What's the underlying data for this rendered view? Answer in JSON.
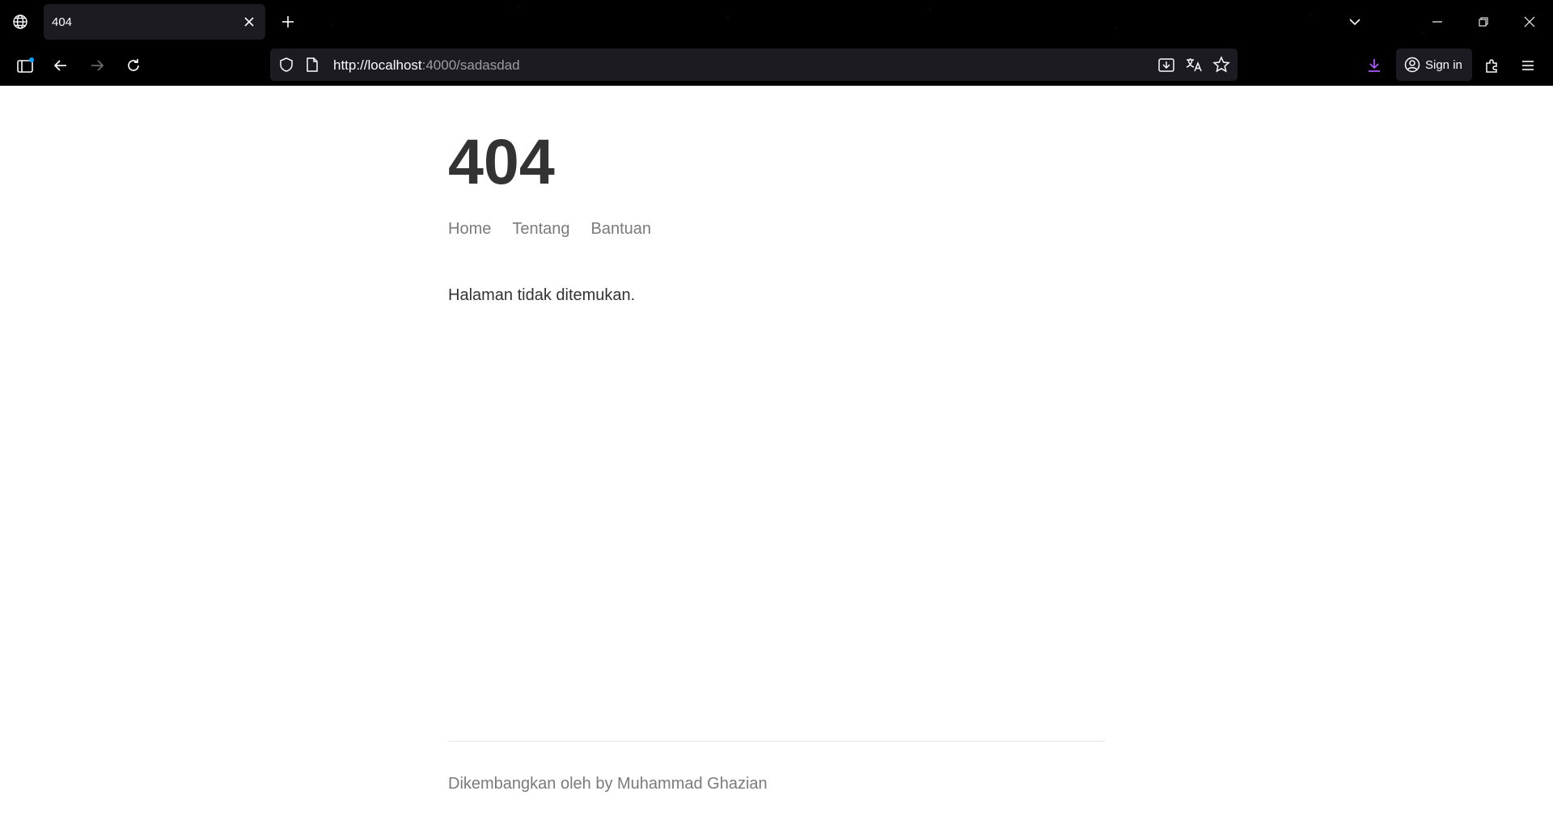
{
  "browser": {
    "tab": {
      "title": "404"
    },
    "url": {
      "host": "http://localhost",
      "path": ":4000/sadasdad"
    },
    "signin_label": "Sign in"
  },
  "site": {
    "title": "404",
    "nav": [
      "Home",
      "Tentang",
      "Bantuan"
    ],
    "message": "Halaman tidak ditemukan.",
    "footer": "Dikembangkan oleh by Muhammad Ghazian"
  },
  "colors": {
    "chrome_bg": "#000000",
    "tab_bg": "#1c1b22",
    "accent_download": "#a855f7",
    "title_text": "#333333",
    "muted_text": "#7a7a7a"
  }
}
